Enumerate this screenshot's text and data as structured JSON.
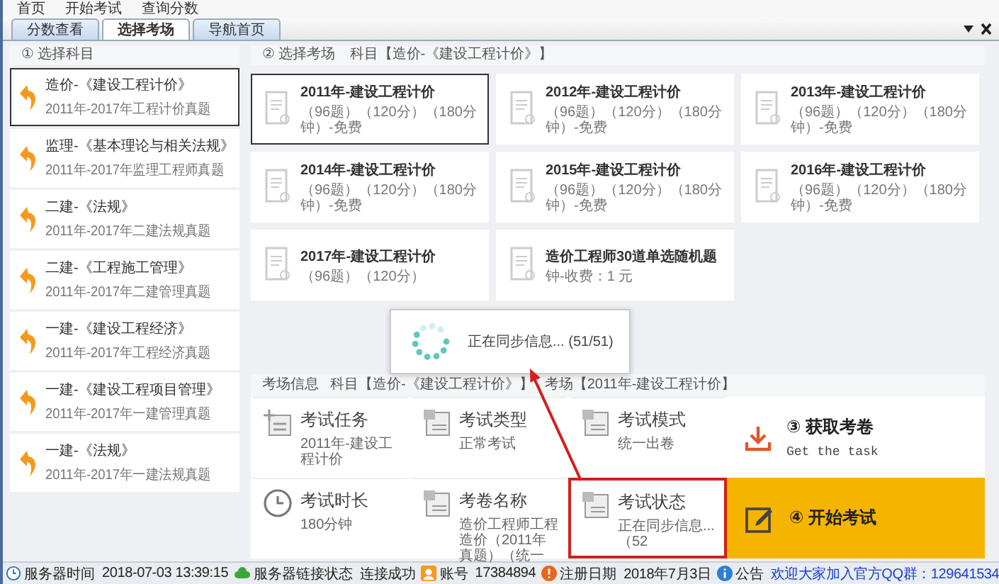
{
  "menu": [
    "首页",
    "开始考试",
    "查询分数"
  ],
  "tabs": [
    {
      "label": "分数查看",
      "selected": false
    },
    {
      "label": "选择考场",
      "selected": true
    },
    {
      "label": "导航首页",
      "selected": false
    }
  ],
  "subjects_panel": {
    "title": "① 选择科目",
    "items": [
      {
        "title": "造价-《建设工程计价》",
        "subtitle": "2011年-2017年工程计价真题",
        "selected": true
      },
      {
        "title": "监理-《基本理论与相关法规》",
        "subtitle": "2011年-2017年监理工程师真题",
        "selected": false
      },
      {
        "title": "二建-《法规》",
        "subtitle": "2011年-2017年二建法规真题",
        "selected": false
      },
      {
        "title": "二建-《工程施工管理》",
        "subtitle": "2011年-2017年二建管理真题",
        "selected": false
      },
      {
        "title": "一建-《建设工程经济》",
        "subtitle": "2011年-2017年工程经济真题",
        "selected": false
      },
      {
        "title": "一建-《建设工程项目管理》",
        "subtitle": "2011年-2017年一建管理真题",
        "selected": false
      },
      {
        "title": "一建-《法规》",
        "subtitle": "2011年-2017年一建法规真题",
        "selected": false
      }
    ]
  },
  "exams_panel": {
    "title": "② 选择考场",
    "subject": "科目【造价-《建设工程计价》】",
    "items": [
      {
        "title": "2011年-建设工程计价",
        "detail": "（96题）（120分）（180分钟）-免费",
        "selected": true
      },
      {
        "title": "2012年-建设工程计价",
        "detail": "（96题）（120分）（180分钟）-免费",
        "selected": false
      },
      {
        "title": "2013年-建设工程计价",
        "detail": "（96题）（120分）（180分钟）-免费",
        "selected": false
      },
      {
        "title": "2014年-建设工程计价",
        "detail": "（96题）（120分）（180分钟）-免费",
        "selected": false
      },
      {
        "title": "2015年-建设工程计价",
        "detail": "（96题）（120分）（180分钟）-免费",
        "selected": false
      },
      {
        "title": "2016年-建设工程计价",
        "detail": "（96题）（120分）（180分钟）-免费",
        "selected": false
      },
      {
        "title": "2017年-建设工程计价",
        "detail": "（96题）（120分）",
        "selected": false
      },
      {
        "title": "造价工程师30道单选随机题",
        "detail": "钟-收费：1 元",
        "selected": false
      }
    ]
  },
  "loading_dialog": {
    "message": "正在同步信息...",
    "progress": "(51/51)"
  },
  "info_panel": {
    "title": "考场信息",
    "subject": "科目【造价-《建设工程计价》】",
    "room": "考场【2011年-建设工程计价】",
    "cells": [
      {
        "kind": "task",
        "label": "考试任务",
        "value": "2011年-建设工程计价",
        "highlighted": false
      },
      {
        "kind": "type",
        "label": "考试类型",
        "value": "正常考试",
        "highlighted": false
      },
      {
        "kind": "mode",
        "label": "考试模式",
        "value": "统一出卷",
        "highlighted": false
      },
      {
        "kind": "duration",
        "label": "考试时长",
        "value": "180分钟",
        "highlighted": false
      },
      {
        "kind": "paper",
        "label": "考卷名称",
        "value": "造价工程师工程造价（2011年真题）（统一",
        "highlighted": false
      },
      {
        "kind": "status",
        "label": "考试状态",
        "value": "正在同步信息...（52",
        "highlighted": true
      }
    ],
    "actions": [
      {
        "kind": "fetch",
        "label": "③ 获取考卷",
        "subtitle": "Get the task"
      },
      {
        "kind": "start",
        "label": "④ 开始考试"
      }
    ]
  },
  "status_bar": [
    {
      "kind": "clock",
      "label": "服务器时间",
      "value": "2018-07-03 13:39:15"
    },
    {
      "kind": "cloud",
      "label": "服务器链接状态",
      "value": "连接成功"
    },
    {
      "kind": "user",
      "label": "账号",
      "value": "17384894"
    },
    {
      "kind": "alert",
      "label": "注册日期",
      "value": "2018年7月3日"
    },
    {
      "kind": "info",
      "label": "公告",
      "value": "欢迎大家加入官方QQ群：129641534"
    }
  ]
}
